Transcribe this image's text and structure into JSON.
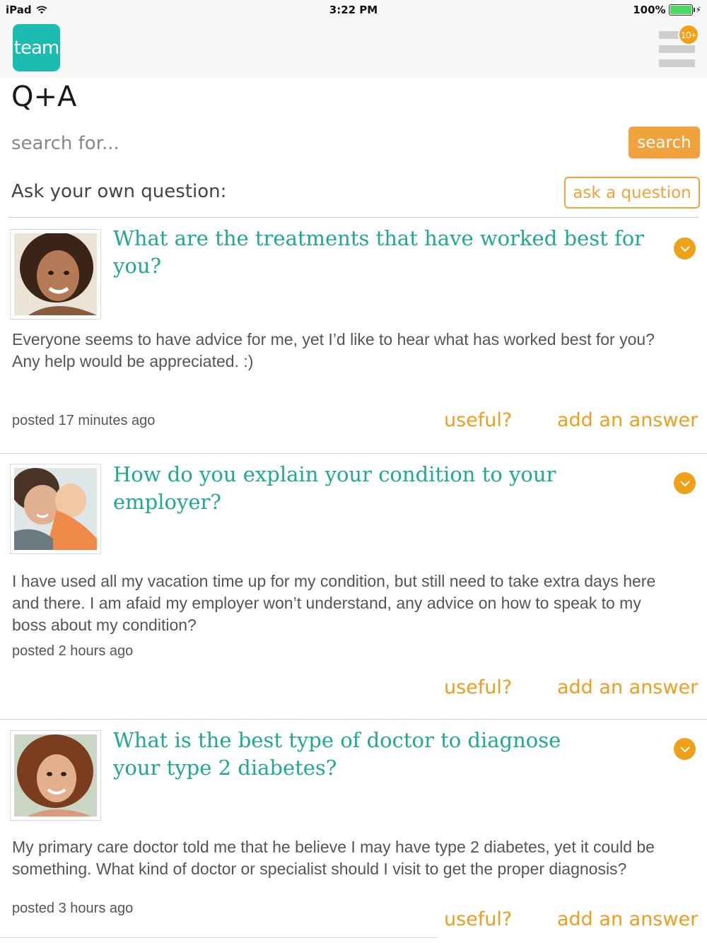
{
  "status_bar": {
    "device": "iPad",
    "time": "3:22 PM",
    "battery": "100%"
  },
  "header": {
    "logo_text": "team",
    "notifications_badge": "10+"
  },
  "page": {
    "title": "Q+A"
  },
  "search": {
    "placeholder": "search for...",
    "button_label": "search"
  },
  "ask": {
    "label": "Ask your own question:",
    "button_label": "ask a question"
  },
  "questions": [
    {
      "title": "What are the treatments that have worked best for you?",
      "body": "Everyone seems to have advice for me, yet I’d like to hear what  has worked best for you? Any help would be appreciated. :)",
      "posted": "posted 17 minutes ago",
      "useful_label": "useful?",
      "answer_label": "add an answer"
    },
    {
      "title": "How do you explain your condition to your employer?",
      "body": "I have used all my vacation time up for my condition, but still need to take extra days here and there.  I am afaid my employer won’t understand, any advice on how to speak to my boss about my condition?",
      "posted": "posted 2 hours ago",
      "useful_label": "useful?",
      "answer_label": "add an answer"
    },
    {
      "title": "What is the best type of doctor to diagnose your type 2 diabetes?",
      "body": "My primary care doctor told me that he believe I may have type 2 diabetes, yet it could be something.  What kind of doctor or specialist should I visit to get the proper diagnosis?",
      "posted": "posted 3 hours ago",
      "useful_label": "useful?",
      "answer_label": "add an answer"
    }
  ]
}
